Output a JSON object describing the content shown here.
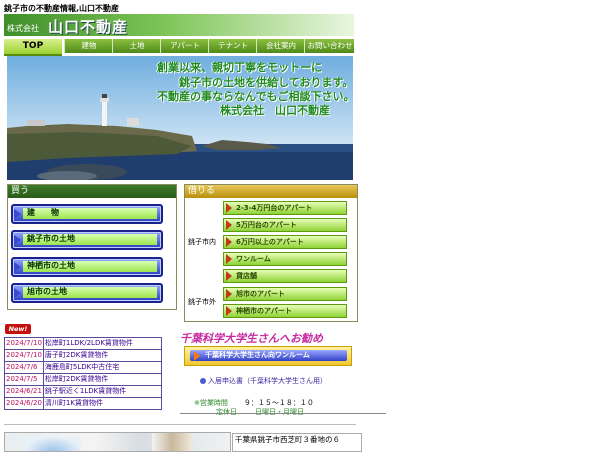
{
  "page": {
    "top_title": "銚子市の不動産情報,山口不動産"
  },
  "logo": {
    "company": "株式会社",
    "name": "山口不動産"
  },
  "nav": {
    "top": "TOP",
    "items": [
      "建物",
      "土地",
      "アパート",
      "テナント",
      "会社案内",
      "お問い合わせ"
    ]
  },
  "hero": {
    "lines": [
      "創業以来、親切丁寧をモットーに",
      "銚子市の土地を供給しております。",
      "不動産の事ならなんでもご相談下さい。",
      "株式会社　山口不動産"
    ]
  },
  "buy": {
    "header": "買う",
    "buttons": [
      "建　　物",
      "銚子市の土地",
      "神栖市の土地",
      "旭市の土地"
    ]
  },
  "rent": {
    "header": "借りる",
    "group1": "銚子市内",
    "group2": "銚子市外",
    "buttons": [
      "2-3-4万円台のアパート",
      "5万円台のアパート",
      "6万円以上のアパート",
      "ワンルーム",
      "貸店舗",
      "旭市のアパート",
      "神栖市のアパート"
    ]
  },
  "news": {
    "badge": "New!",
    "rows": [
      {
        "date": "2024/7/10",
        "title": "松岸町1LDK/2LDK賃貸物件"
      },
      {
        "date": "2024/7/10",
        "title": "唐子町2DK賃貸物件"
      },
      {
        "date": "2024/7/6",
        "title": "海鹿島町5LDK中古住宅"
      },
      {
        "date": "2024/7/5",
        "title": "松岸町2DK賃貸物件"
      },
      {
        "date": "2024/6/21",
        "title": "銚子駅近く1LDK賃貸物件"
      },
      {
        "date": "2024/6/20",
        "title": "清川町1K賃貸物件"
      }
    ]
  },
  "promo": {
    "title": "千葉科学大学生さんへお勧め",
    "button": "千葉科学大学生さん向ワンルーム",
    "apply": "入居申込書（千葉科学大学生さん用）"
  },
  "hours": {
    "label": "※営業時間",
    "value": "９：１５～１８：１０",
    "closed_label": "定休日",
    "closed_value": "日曜日・月曜日"
  },
  "footer": {
    "address": "千葉県銚子市西芝町３番地の６"
  },
  "colors": {
    "brand_green": "#4e8a18",
    "buy_header": "#2a5c18",
    "rent_header": "#b8900a",
    "news_date": "#c01060",
    "promo_pink": "#c62aa0"
  }
}
